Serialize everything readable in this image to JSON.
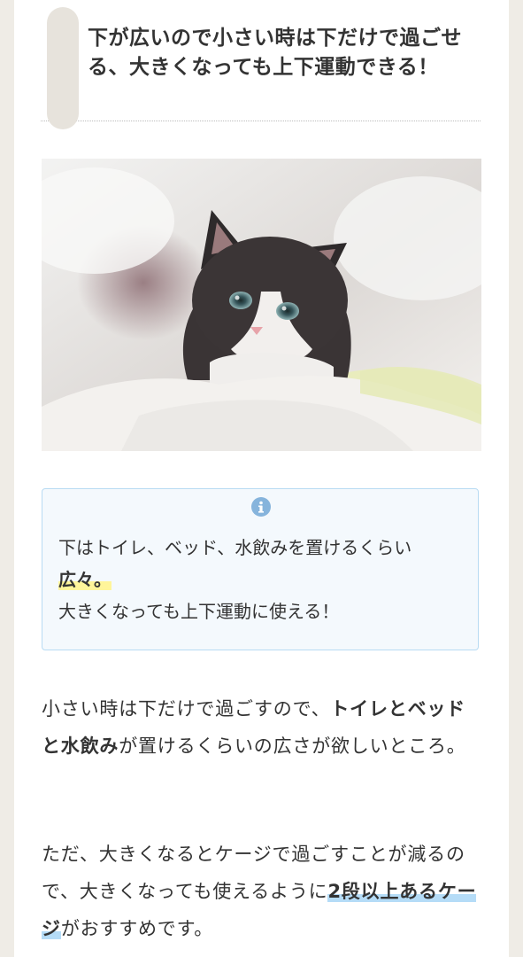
{
  "heading": {
    "text": "下が広いので小さい時は下だけで過ごせる、大きくなっても上下運動できる！"
  },
  "hero_image": {
    "subject": "kitten-photo"
  },
  "info_box": {
    "icon": "info-icon",
    "line1": "下はトイレ、ベッド、水飲みを置けるくらい",
    "highlight": "広々。",
    "line2": "大きくなっても上下運動に使える！"
  },
  "paragraph1": {
    "part1": "小さい時は下だけで過ごすので、",
    "bold": "トイレとベッドと水飲み",
    "part2": "が置けるくらいの広さが欲しいところ。"
  },
  "paragraph2": {
    "part1": "ただ、大きくなるとケージで過ごすことが減るので、大きくなっても使えるように",
    "highlight": "2段以上あるケージ",
    "part2": "がおすすめです。"
  },
  "colors": {
    "background": "#efece6",
    "heading_accent": "#e7e3dc",
    "info_border": "#b8dbf3",
    "info_bg": "#f4f9fd",
    "highlight_yellow": "#fff59a",
    "highlight_blue": "#b5dcf7"
  }
}
